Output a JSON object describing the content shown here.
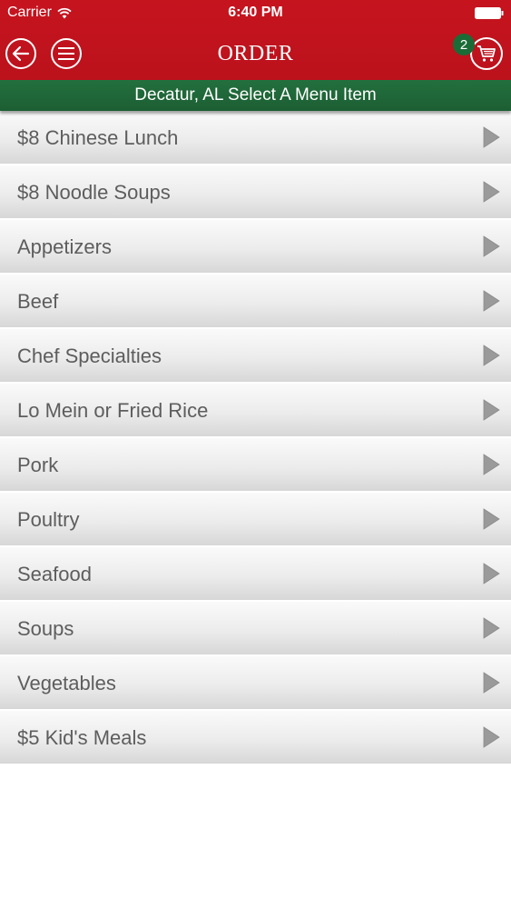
{
  "status_bar": {
    "carrier": "Carrier",
    "time": "6:40 PM"
  },
  "nav": {
    "title": "ORDER",
    "cart_count": "2"
  },
  "location_bar": {
    "text": "Decatur, AL  Select A Menu Item"
  },
  "menu": {
    "items": [
      {
        "label": "$8 Chinese Lunch"
      },
      {
        "label": "$8 Noodle Soups"
      },
      {
        "label": "Appetizers"
      },
      {
        "label": "Beef"
      },
      {
        "label": "Chef Specialties"
      },
      {
        "label": "Lo Mein or Fried Rice"
      },
      {
        "label": "Pork"
      },
      {
        "label": "Poultry"
      },
      {
        "label": "Seafood"
      },
      {
        "label": "Soups"
      },
      {
        "label": "Vegetables"
      },
      {
        "label": "$5 Kid's Meals"
      }
    ]
  },
  "colors": {
    "nav_red": "#c6141f",
    "location_green": "#23703e",
    "badge_green": "#1b6b36",
    "item_text": "#5d5d5d",
    "arrow_gray": "#9a9a9a"
  },
  "icons": {
    "back": "arrow-left-circle-icon",
    "menu": "hamburger-menu-icon",
    "cart": "shopping-cart-icon",
    "wifi": "wifi-icon",
    "battery": "battery-icon",
    "row_arrow": "triangle-right-icon"
  }
}
